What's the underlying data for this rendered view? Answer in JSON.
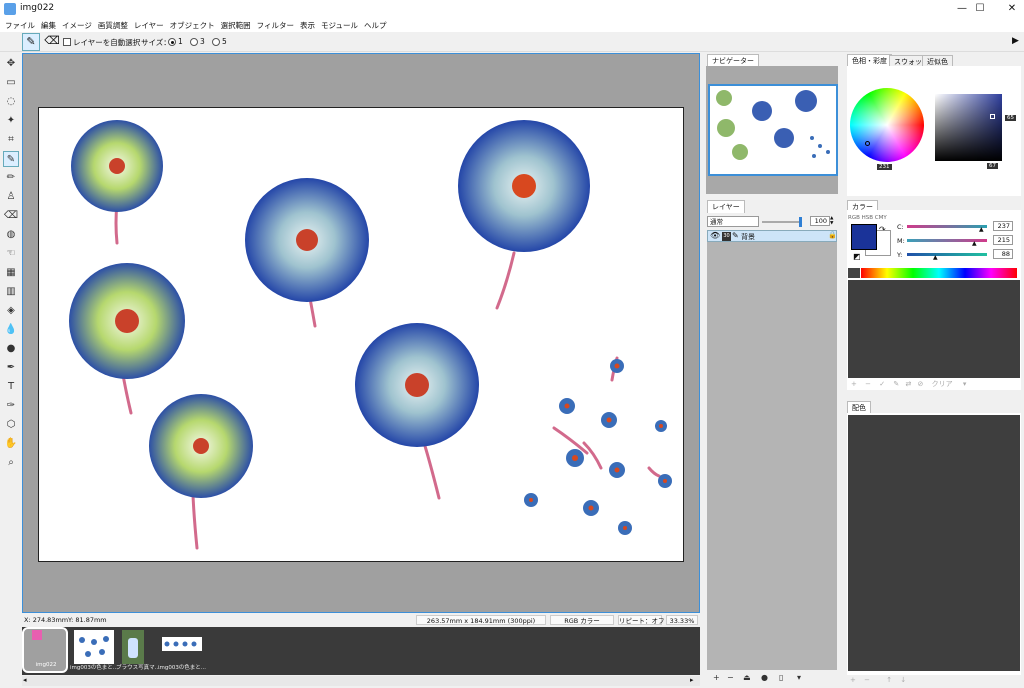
{
  "window": {
    "title": "img022",
    "minimize": "—",
    "maximize": "☐",
    "close": "✕"
  },
  "menu": [
    "ファイル",
    "編集",
    "イメージ",
    "画質調整",
    "レイヤー",
    "オブジェクト",
    "選択範囲",
    "フィルター",
    "表示",
    "モジュール",
    "ヘルプ"
  ],
  "tool_options": {
    "auto_select_label": "レイヤーを自動選択",
    "size_label": "サイズ：",
    "sizes": [
      "1",
      "3",
      "5"
    ],
    "selected_size": "1"
  },
  "tools": [
    "move-icon",
    "rect-select-icon",
    "lasso-select-icon",
    "magic-wand-icon",
    "crop-icon",
    "eyedropper-icon",
    "pencil-icon",
    "stamp-icon",
    "eraser-icon",
    "blur-icon",
    "smudge-icon",
    "pattern-icon",
    "gradient-icon",
    "fill-icon",
    "water-drop-icon",
    "dodge-icon",
    "pen-icon",
    "text-icon",
    "vector-pen-icon",
    "transform-icon",
    "hand-icon",
    "zoom-icon"
  ],
  "status": {
    "x": "X:  274.83mm",
    "y": "Y:   81.87mm",
    "size": "263.57mm x 184.91mm (300ppi)",
    "mode": "RGB カラー",
    "repeat": "リピート：オフ",
    "zoom": "33.33%"
  },
  "tabs": [
    {
      "caption": "img022",
      "active": true
    },
    {
      "caption": "img003の色まと...",
      "active": false
    },
    {
      "caption": "ブラウス写真マ...",
      "active": false
    },
    {
      "caption": "img003の色まと...",
      "active": false
    }
  ],
  "navigator": {
    "title": "ナビゲーター"
  },
  "layers": {
    "title": "レイヤー",
    "blend_mode": "通常",
    "opacity": "100",
    "layer_name": "背景",
    "layer_type_badge": "30"
  },
  "color_panel": {
    "tabs": [
      "色相・彩度",
      "スウォッチ",
      "近似色"
    ],
    "hue_value": "231",
    "sat_value": "65",
    "val_value": "67"
  },
  "color2": {
    "title": "カラー",
    "modes": "RGB HSB CMY",
    "c_label": "C:",
    "m_label": "M:",
    "y_label": "Y:",
    "c": "237",
    "m": "215",
    "y": "88",
    "fg_color": "#1a3399"
  },
  "color2_toolbar": {
    "clear_label": "クリア"
  },
  "palette": {
    "title": "配色"
  }
}
